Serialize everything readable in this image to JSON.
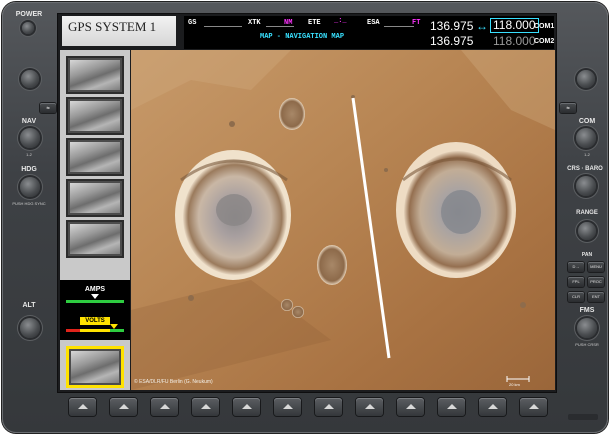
{
  "left_panel": {
    "power_label": "POWER",
    "nav_label": "NAV",
    "nav_sub": "1-2",
    "hdg_label": "HDG",
    "hdg_sub": "PUSH HDG SYNC",
    "alt_label": "ALT"
  },
  "header": {
    "title": "GPS SYSTEM 1",
    "gs_label": "GS",
    "xtk_label": "XTK",
    "xtk_unit": "NM",
    "ete_label": "ETE",
    "ete_value": "_:_",
    "esa_label": "ESA",
    "esa_unit": "FT",
    "map_title": "MAP - NAVIGATION MAP",
    "freq_active_1": "136.975",
    "swap_icon": "↔",
    "freq_standby_1": "118.000",
    "com1_label": "COM1",
    "freq_active_2": "136.975",
    "freq_standby_2": "118.000",
    "com2_label": "COM2"
  },
  "sidebar": {
    "thumbnails": [
      "thumb-1",
      "thumb-2",
      "thumb-3",
      "thumb-4",
      "thumb-5"
    ],
    "amps_label": "AMPS",
    "volts_label": "VOLTS"
  },
  "map": {
    "credit": "© ESA/DLR/FU Berlin (G. Neukum)",
    "scale_label": "20 km"
  },
  "right_panel": {
    "com_label": "COM",
    "com_sub": "1-2",
    "crs_baro_label": "CRS · BARO",
    "range_label": "RANGE",
    "pan_label": "PAN",
    "buttons": [
      "D→",
      "MENU",
      "FPL",
      "PROC",
      "CLR",
      "ENT"
    ],
    "fms_label": "FMS",
    "fms_sub": "PUSH CRSR"
  },
  "softkeys": [
    "sk1",
    "sk2",
    "sk3",
    "sk4",
    "sk5",
    "sk6",
    "sk7",
    "sk8",
    "sk9",
    "sk10",
    "sk11",
    "sk12"
  ],
  "colors": {
    "accent_cyan": "#38e0ff",
    "magenta": "#ff33ff",
    "highlight_yellow": "#ffe200"
  }
}
